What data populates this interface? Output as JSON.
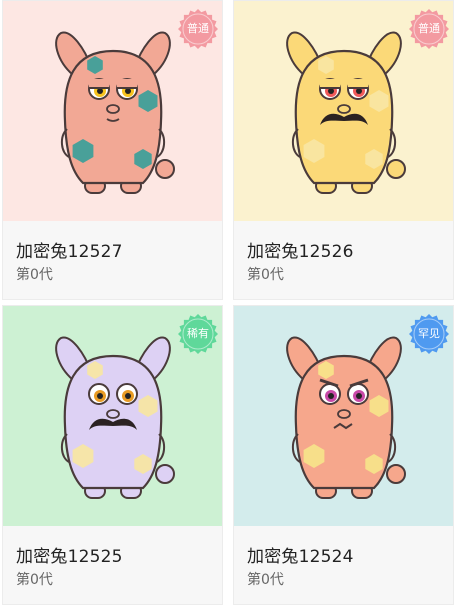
{
  "cards": [
    {
      "name": "加密兔12527",
      "generation": "第0代",
      "rarity": "普通",
      "colors": {
        "bg": "#fde7e3",
        "body": "#f2a895",
        "pattern": "#3f9f99",
        "badge": "#f39aa1",
        "eye": "#f7c31e"
      },
      "features": {
        "mustache": false,
        "expression": "sleepy"
      }
    },
    {
      "name": "加密兔12526",
      "generation": "第0代",
      "rarity": "普通",
      "colors": {
        "bg": "#fbf2cf",
        "body": "#fbd978",
        "pattern": "#f9e6a3",
        "badge": "#f39aa1",
        "eye": "#f05a5a"
      },
      "features": {
        "mustache": true,
        "expression": "sleepy"
      }
    },
    {
      "name": "加密兔12525",
      "generation": "第0代",
      "rarity": "稀有",
      "colors": {
        "bg": "#cdf1d3",
        "body": "#ddd1f4",
        "pattern": "#f7e6a4",
        "badge": "#5fd89a",
        "eye": "#e89b24"
      },
      "features": {
        "mustache": true,
        "expression": "surprised"
      }
    },
    {
      "name": "加密兔12524",
      "generation": "第0代",
      "rarity": "罕见",
      "colors": {
        "bg": "#d3ecec",
        "body": "#f6a78c",
        "pattern": "#f8e38a",
        "badge": "#4f9af0",
        "eye": "#c84aa8"
      },
      "features": {
        "mustache": false,
        "expression": "angry"
      }
    }
  ]
}
